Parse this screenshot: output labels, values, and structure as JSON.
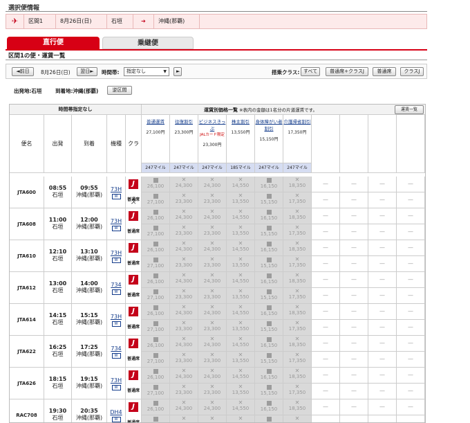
{
  "page_title": "選択便情報",
  "selected": {
    "segment": "区間1",
    "date": "8月26日(日)",
    "from": "石垣",
    "to": "沖縄(那覇)"
  },
  "tabs": [
    {
      "label": "直行便"
    },
    {
      "label": "乗継便"
    }
  ],
  "section_title": "区間1の便・運賃一覧",
  "controls": {
    "prev": "◄前日",
    "date": "8月26日(日)",
    "next": "翌日►",
    "time_label": "時間帯:",
    "time_value": "指定なし",
    "time_arrow": "►",
    "class_label": "搭乗クラス:",
    "class_all": "すべて",
    "class_std_j": "普通席+クラスJ",
    "class_std": "普通席",
    "class_j": "クラスJ"
  },
  "route": {
    "from_label": "出発地:石垣",
    "to_label": "到着地:沖縄(那覇)",
    "reverse": "逆区間"
  },
  "table": {
    "left_header": "時間帯指定なし",
    "right_header": "運賃別価格一覧",
    "right_note": "※表内の金額は1名分の片道運賃です。",
    "list_button": "運賃一覧",
    "cols": {
      "flight": "便名",
      "dep": "出発",
      "arr": "到着",
      "type": "機種",
      "class": "クラス"
    },
    "fare_types": [
      {
        "name": "普通運賃",
        "sub": "",
        "price": "27,100円",
        "miles": "247マイル"
      },
      {
        "name": "往復割引",
        "sub": "",
        "price": "23,300円",
        "miles": "247マイル"
      },
      {
        "name": "ビジネスきっぷ",
        "sub": "JALカード限定",
        "price": "23,300円",
        "miles": "247マイル"
      },
      {
        "name": "株主割引",
        "sub": "",
        "price": "13,550円",
        "miles": "185マイル"
      },
      {
        "name": "身体障がい者割引",
        "sub": "",
        "price": "15,150円",
        "miles": "247マイル"
      },
      {
        "name": "介護帰省割引",
        "sub": "",
        "price": "17,350円",
        "miles": "247マイル"
      }
    ],
    "flights": [
      {
        "no": "JTA600",
        "dep": "08:55",
        "dep_city": "石垣",
        "arr": "09:55",
        "arr_city": "沖縄(那覇)",
        "type": "73H",
        "cls": "普通席"
      },
      {
        "no": "JTA608",
        "dep": "11:00",
        "dep_city": "石垣",
        "arr": "12:00",
        "arr_city": "沖縄(那覇)",
        "type": "73H",
        "cls": "普通席"
      },
      {
        "no": "JTA610",
        "dep": "12:10",
        "dep_city": "石垣",
        "arr": "13:10",
        "arr_city": "沖縄(那覇)",
        "type": "73H",
        "cls": "普通席"
      },
      {
        "no": "JTA612",
        "dep": "13:00",
        "dep_city": "石垣",
        "arr": "14:00",
        "arr_city": "沖縄(那覇)",
        "type": "734",
        "cls": "普通席"
      },
      {
        "no": "JTA614",
        "dep": "14:15",
        "dep_city": "石垣",
        "arr": "15:15",
        "arr_city": "沖縄(那覇)",
        "type": "73H",
        "cls": "普通席"
      },
      {
        "no": "JTA622",
        "dep": "16:25",
        "dep_city": "石垣",
        "arr": "17:25",
        "arr_city": "沖縄(那覇)",
        "type": "734",
        "cls": "普通席"
      },
      {
        "no": "JTA626",
        "dep": "18:15",
        "dep_city": "石垣",
        "arr": "19:15",
        "arr_city": "沖縄(那覇)",
        "type": "73H",
        "cls": "普通席"
      },
      {
        "no": "RAC708",
        "dep": "19:30",
        "dep_city": "石垣",
        "arr": "20:35",
        "arr_city": "沖縄(那覇)",
        "type": "DH4",
        "cls": "普通席"
      }
    ],
    "row_prices": [
      [
        "26,100",
        "24,300",
        "24,300",
        "14,550",
        "16,150",
        "18,350"
      ],
      [
        "27,100",
        "23,300",
        "23,300",
        "13,550",
        "15,150",
        "17,350"
      ]
    ],
    "dash": "—",
    "bottom_miles": [
      "247マイル",
      "247マイル",
      "247マイル",
      "185マイル",
      "247マイル",
      "247マイル"
    ]
  }
}
